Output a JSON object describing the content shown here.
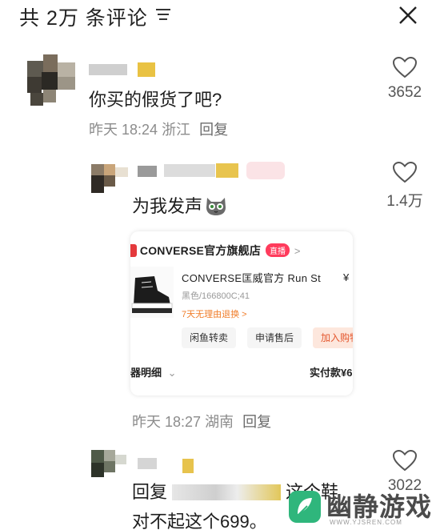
{
  "header": {
    "title": "共 2万 条评论",
    "sort_icon": "sort-lines-icon",
    "close_icon": "close-x-icon"
  },
  "comments": [
    {
      "text": "你买的假货了吧?",
      "time": "昨天 18:24",
      "location": "浙江",
      "reply_label": "回复",
      "likes": "3652"
    },
    {
      "text": "为我发声",
      "emoji": "cat-face-emoji",
      "time": "昨天 18:27",
      "location": "湖南",
      "reply_label": "回复",
      "likes": "1.4万"
    },
    {
      "text_prefix": "回复",
      "text_suffix": "这个鞋",
      "text_line2": "对不起这个699。",
      "likes": "3022"
    }
  ],
  "order_card": {
    "store_name": "CONVERSE官方旗舰店",
    "live_badge": "直播",
    "product_title": "CONVERSE匡威官方 Run St",
    "price_prefix": "¥",
    "sku": "黑色/166800C;41",
    "return_policy": "7天无理由退换 >",
    "buttons": [
      "闲鱼转卖",
      "申请售后",
      "加入购物"
    ],
    "detail_label": "器明细",
    "paid_label": "实付款¥6"
  },
  "watermark": {
    "text": "幽静游戏",
    "url": "WWW.YJSREN.COM"
  },
  "colors": {
    "like_icon": "#555555",
    "meta_text": "#8c8c8c",
    "brand_red": "#e4393c",
    "watermark_green": "#2fb67c"
  }
}
